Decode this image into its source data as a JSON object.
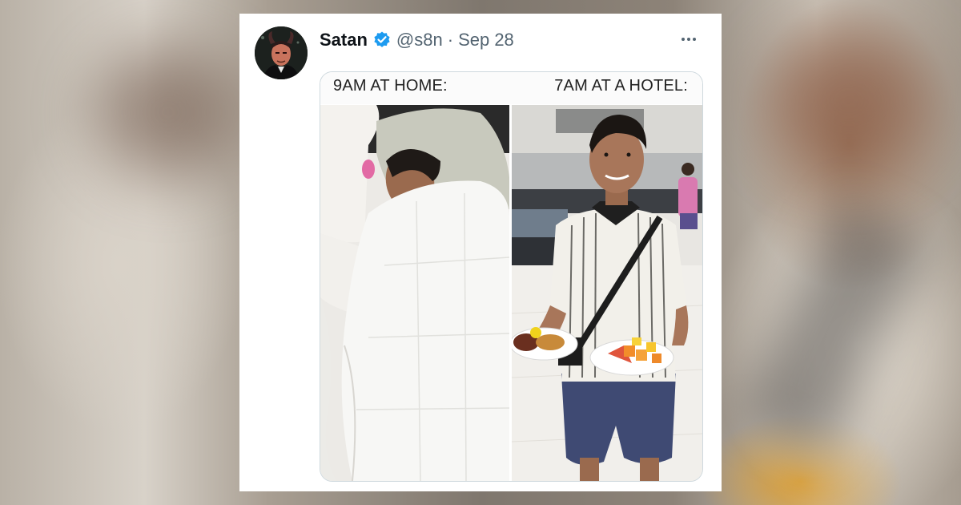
{
  "tweet": {
    "display_name": "Satan",
    "handle": "@s8n",
    "separator": "·",
    "date": "Sep 28",
    "verified": true
  },
  "media": {
    "left_caption": "9AM AT HOME:",
    "right_caption": "7AM AT A HOTEL:"
  },
  "icons": {
    "verified": "verified-badge-icon",
    "more": "more-options-icon"
  },
  "colors": {
    "verified": "#1d9bf0",
    "name": "#0f1419",
    "secondary": "#536471",
    "card": "#ffffff"
  }
}
